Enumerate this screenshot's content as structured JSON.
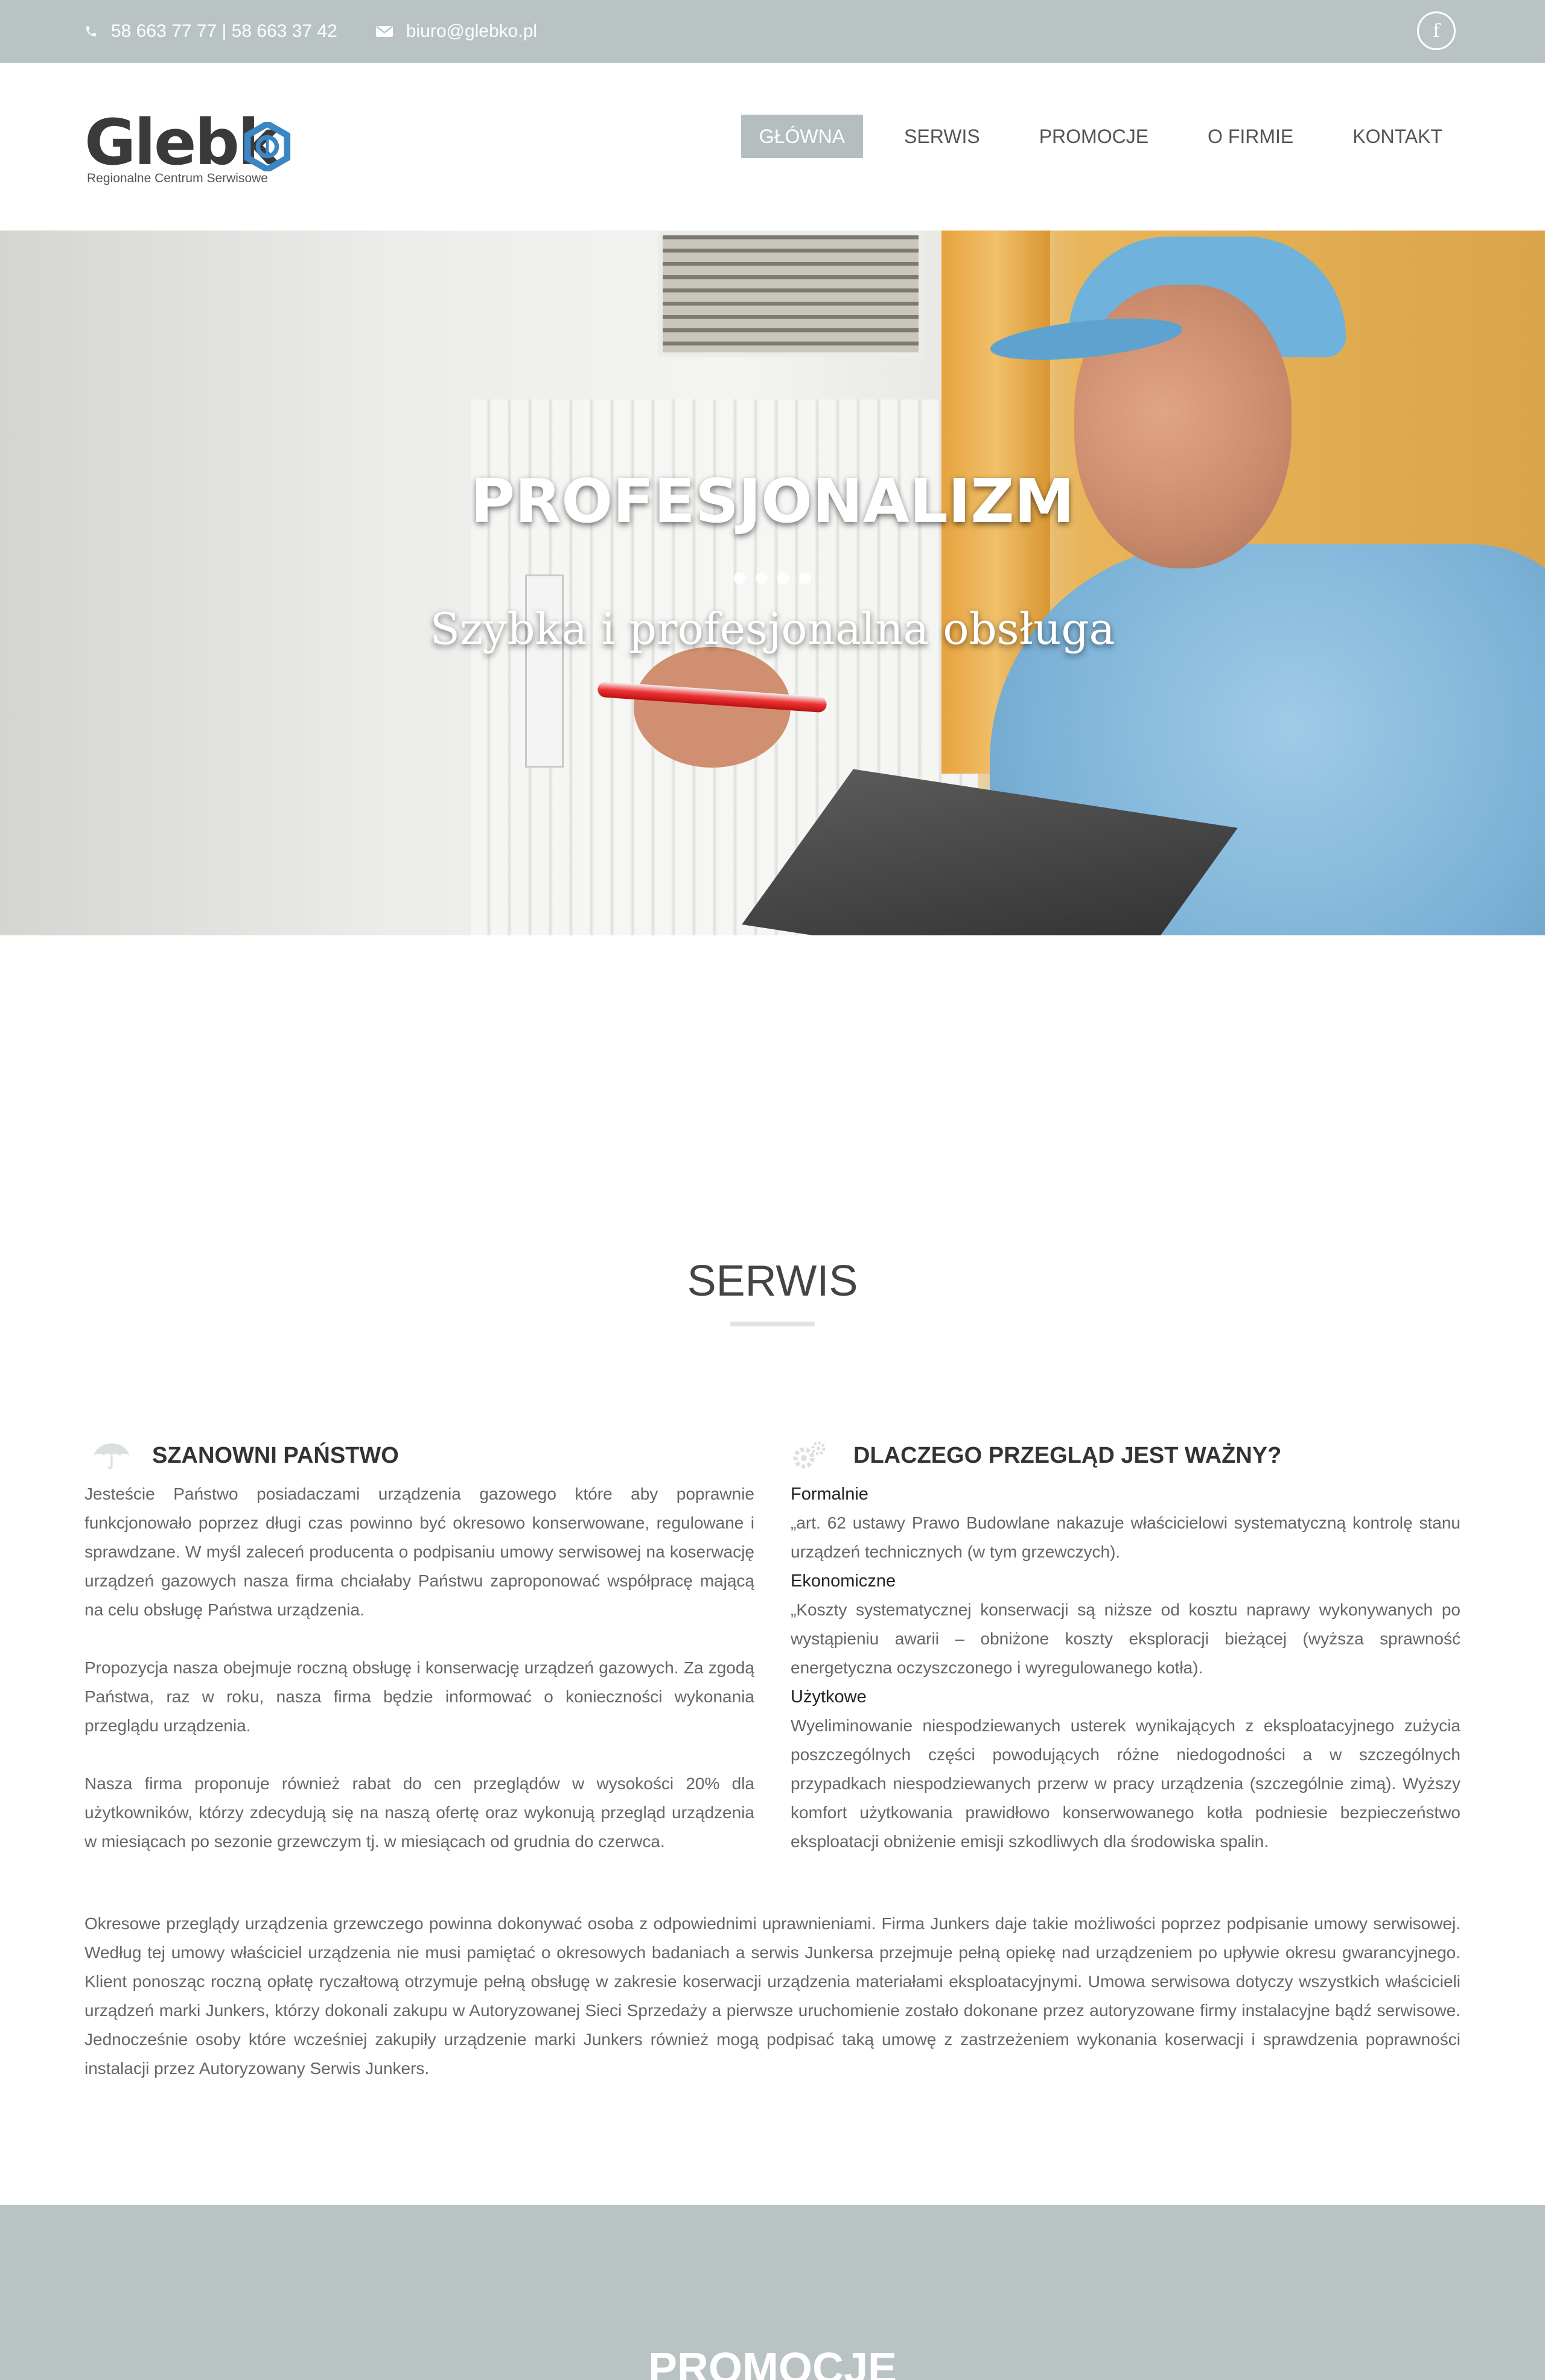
{
  "topbar": {
    "phone": "58 663 77 77 | 58 663 37 42",
    "email": "biuro@glebko.pl",
    "facebook_label": "f"
  },
  "header": {
    "logo_text": "Glebk",
    "logo_subtitle": "Regionalne Centrum Serwisowe",
    "nav": [
      {
        "label": "GŁÓWNA",
        "active": true
      },
      {
        "label": "SERWIS",
        "active": false
      },
      {
        "label": "PROMOCJE",
        "active": false
      },
      {
        "label": "O FIRMIE",
        "active": false
      },
      {
        "label": "KONTAKT",
        "active": false
      }
    ]
  },
  "hero": {
    "title": "PROFESJONALIZM",
    "subtitle": "Szybka i profesjonalna obsługa",
    "slide_count": 4
  },
  "serwis": {
    "title": "SERWIS",
    "left": {
      "icon": "umbrella-icon",
      "heading": "SZANOWNI PAŃSTWO",
      "paragraphs": [
        "Jesteście Państwo posiadaczami urządzenia gazowego które aby poprawnie funkcjonowało poprzez długi czas powinno być okresowo konserwowane, regulowane i sprawdzane. W myśl zaleceń producenta o podpisaniu umowy serwisowej na koserwację urządzeń gazowych nasza firma chciałaby Państwu zaproponować współpracę mającą na celu obsługę Państwa urządzenia.",
        "Propozycja nasza obejmuje roczną obsługę i konserwację urządzeń gazowych. Za zgodą Państwa, raz w roku, nasza firma będzie informować o konieczności wykonania przeglądu urządzenia.",
        "Nasza firma proponuje również rabat do cen przeglądów w wysokości 20% dla użytkowników, którzy zdecydują się na naszą ofertę oraz wykonują przegląd urządzenia w miesiącach po sezonie grzewczym tj. w miesiącach od grudnia do czerwca."
      ]
    },
    "right": {
      "icon": "gears-icon",
      "heading": "DLACZEGO PRZEGLĄD JEST WAŻNY?",
      "blocks": [
        {
          "subheading": "Formalnie",
          "text": "„art. 62 ustawy Prawo Budowlane nakazuje właścicielowi systematyczną kontrolę stanu urządzeń technicznych (w tym grzewczych)."
        },
        {
          "subheading": "Ekonomiczne",
          "text": "„Koszty systematycznej konserwacji są niższe od kosztu naprawy wykonywanych po wystąpieniu awarii – obniżone koszty eksploracji bieżącej (wyższa sprawność energetyczna oczyszczonego i wyregulowanego kotła)."
        },
        {
          "subheading": "Użytkowe",
          "text": "Wyeliminowanie niespodziewanych usterek wynikających z eksploatacyjnego zużycia poszczególnych części powodujących różne niedogodności a w szczególnych przypadkach niespodziewanych przerw w pracy urządzenia (szczególnie zimą). Wyższy komfort użytkowania prawidłowo konserwowanego kotła podniesie bezpieczeństwo eksploatacji obniżenie emisji szkodliwych dla środowiska spalin."
        }
      ]
    },
    "full_paragraph": "Okresowe przeglądy urządzenia grzewczego powinna dokonywać osoba z odpowiednimi uprawnieniami. Firma Junkers daje takie możliwości poprzez podpisanie umowy serwisowej. Według tej umowy właściciel urządzenia nie musi pamiętać o okresowych badaniach a serwis Junkersa przejmuje pełną opiekę nad urządzeniem po upływie okresu gwarancyjnego. Klient ponosząc roczną opłatę ryczałtową otrzymuje pełną obsługę w zakresie koserwacji urządzenia materiałami eksploatacyjnymi. Umowa serwisowa dotyczy wszystkich właścicieli urządzeń marki Junkers, którzy dokonali zakupu w Autoryzowanej Sieci Sprzedaży a pierwsze uruchomienie zostało dokonane przez autoryzowane firmy instalacyjne bądź serwisowe. Jednocześnie osoby które wcześniej zakupiły urządzenie marki Junkers również mogą podpisać taką umowę z zastrzeżeniem wykonania koserwacji i sprawdzenia poprawności instalacji przez Autoryzowany Serwis Junkers."
  },
  "promocje": {
    "title": "PROMOCJE"
  },
  "colors": {
    "topbar_bg": "#bac3c3",
    "nav_active_bg": "#b4bebe",
    "logo_accent": "#3b86c4",
    "text": "#666666",
    "heading": "#333333"
  }
}
